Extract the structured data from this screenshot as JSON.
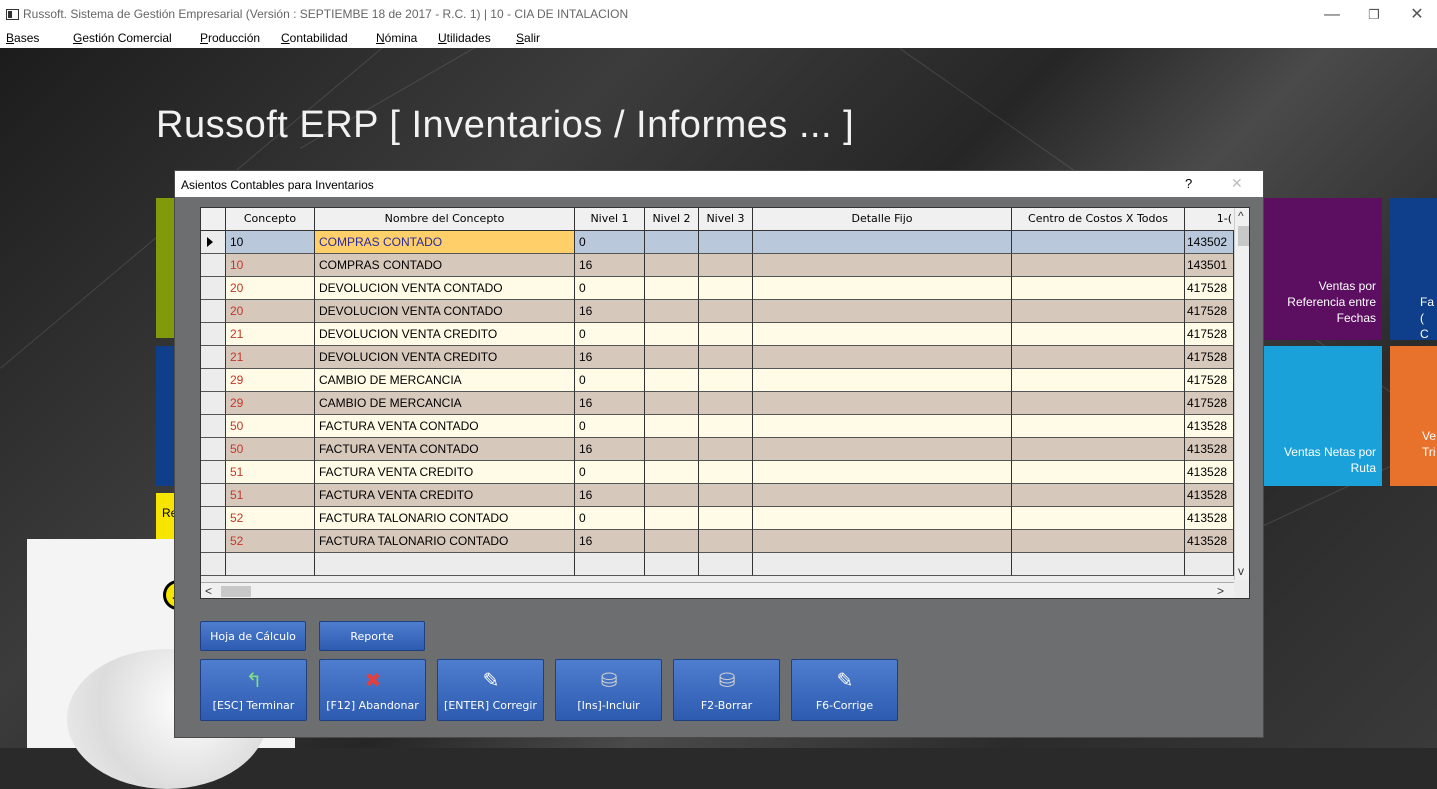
{
  "window": {
    "title": "Russoft. Sistema de Gestión Empresarial (Versión : SEPTIEMBE 18 de 2017 - R.C. 1) | 10 - CIA DE INTALACION",
    "minimize": "—",
    "maximize": "❐",
    "close": "✕"
  },
  "menu": [
    "Bases",
    "Gestión Comercial",
    "Producción",
    "Contabilidad",
    "Nómina",
    "Utilidades",
    "Salir"
  ],
  "app_title": "Russoft ERP [ Inventarios / Informes ... ]",
  "tiles": {
    "ventas_ref": "Ventas por Referencia entre Fechas",
    "ventas_netas": "Ventas Netas por Ruta",
    "fa_partial": "Fa ( C",
    "ve_partial": "Ve Tri",
    "reg_partial": "Reg"
  },
  "dialog": {
    "title": "Asientos Contables para Inventarios",
    "help": "?",
    "close": "✕",
    "columns": [
      "Concepto",
      "Nombre del Concepto",
      "Nivel 1",
      "Nivel 2",
      "Nivel 3",
      "Detalle Fijo",
      "Centro de Costos X Todos",
      "1-("
    ],
    "rows": [
      {
        "concepto": "10",
        "nombre": "COMPRAS CONTADO",
        "nivel1": "0",
        "cuenta": "143502"
      },
      {
        "concepto": "10",
        "nombre": "COMPRAS CONTADO",
        "nivel1": "16",
        "cuenta": "143501"
      },
      {
        "concepto": "20",
        "nombre": "DEVOLUCION VENTA CONTADO",
        "nivel1": "0",
        "cuenta": "417528"
      },
      {
        "concepto": "20",
        "nombre": "DEVOLUCION VENTA CONTADO",
        "nivel1": "16",
        "cuenta": "417528"
      },
      {
        "concepto": "21",
        "nombre": "DEVOLUCION VENTA CREDITO",
        "nivel1": "0",
        "cuenta": "417528"
      },
      {
        "concepto": "21",
        "nombre": "DEVOLUCION VENTA CREDITO",
        "nivel1": "16",
        "cuenta": "417528"
      },
      {
        "concepto": "29",
        "nombre": "CAMBIO DE MERCANCIA",
        "nivel1": "0",
        "cuenta": "417528"
      },
      {
        "concepto": "29",
        "nombre": "CAMBIO DE MERCANCIA",
        "nivel1": "16",
        "cuenta": "417528"
      },
      {
        "concepto": "50",
        "nombre": "FACTURA VENTA CONTADO",
        "nivel1": "0",
        "cuenta": "413528"
      },
      {
        "concepto": "50",
        "nombre": "FACTURA VENTA CONTADO",
        "nivel1": "16",
        "cuenta": "413528"
      },
      {
        "concepto": "51",
        "nombre": "FACTURA VENTA CREDITO",
        "nivel1": "0",
        "cuenta": "413528"
      },
      {
        "concepto": "51",
        "nombre": "FACTURA VENTA CREDITO",
        "nivel1": "16",
        "cuenta": "413528"
      },
      {
        "concepto": "52",
        "nombre": "FACTURA TALONARIO CONTADO",
        "nivel1": "0",
        "cuenta": "413528"
      },
      {
        "concepto": "52",
        "nombre": "FACTURA TALONARIO CONTADO",
        "nivel1": "16",
        "cuenta": "413528"
      }
    ],
    "buttons_small": [
      "Hoja de Cálculo",
      "Reporte"
    ],
    "buttons_large": [
      {
        "label": "[ESC] Terminar",
        "icon": "exit-arrow-icon",
        "glyph": "↰",
        "color": "#7fe07f"
      },
      {
        "label": "[F12] Abandonar",
        "icon": "cancel-icon",
        "glyph": "✖",
        "color": "#e04040"
      },
      {
        "label": "[ENTER] Corregir",
        "icon": "edit-icon",
        "glyph": "✎",
        "color": "#ffffff"
      },
      {
        "label": "[Ins]-Incluir",
        "icon": "add-database-icon",
        "glyph": "⛁",
        "color": "#d0d0d0"
      },
      {
        "label": "F2-Borrar",
        "icon": "delete-database-icon",
        "glyph": "⛁",
        "color": "#d0d0d0"
      },
      {
        "label": "F6-Corrige",
        "icon": "edit-icon",
        "glyph": "✎",
        "color": "#ffffff"
      }
    ]
  },
  "colors": {
    "tile_purple": "#5c0f60",
    "tile_blue": "#0f3f8a",
    "tile_cyan": "#1ba1d9",
    "tile_orange": "#e8712b",
    "tile_green": "#7f9a0a",
    "tile_yellow": "#f5e500",
    "row_even": "#fffbe6",
    "row_odd": "#d7c8bc",
    "selected_row": "#b9c9db",
    "concepto_red": "#c0392b"
  }
}
